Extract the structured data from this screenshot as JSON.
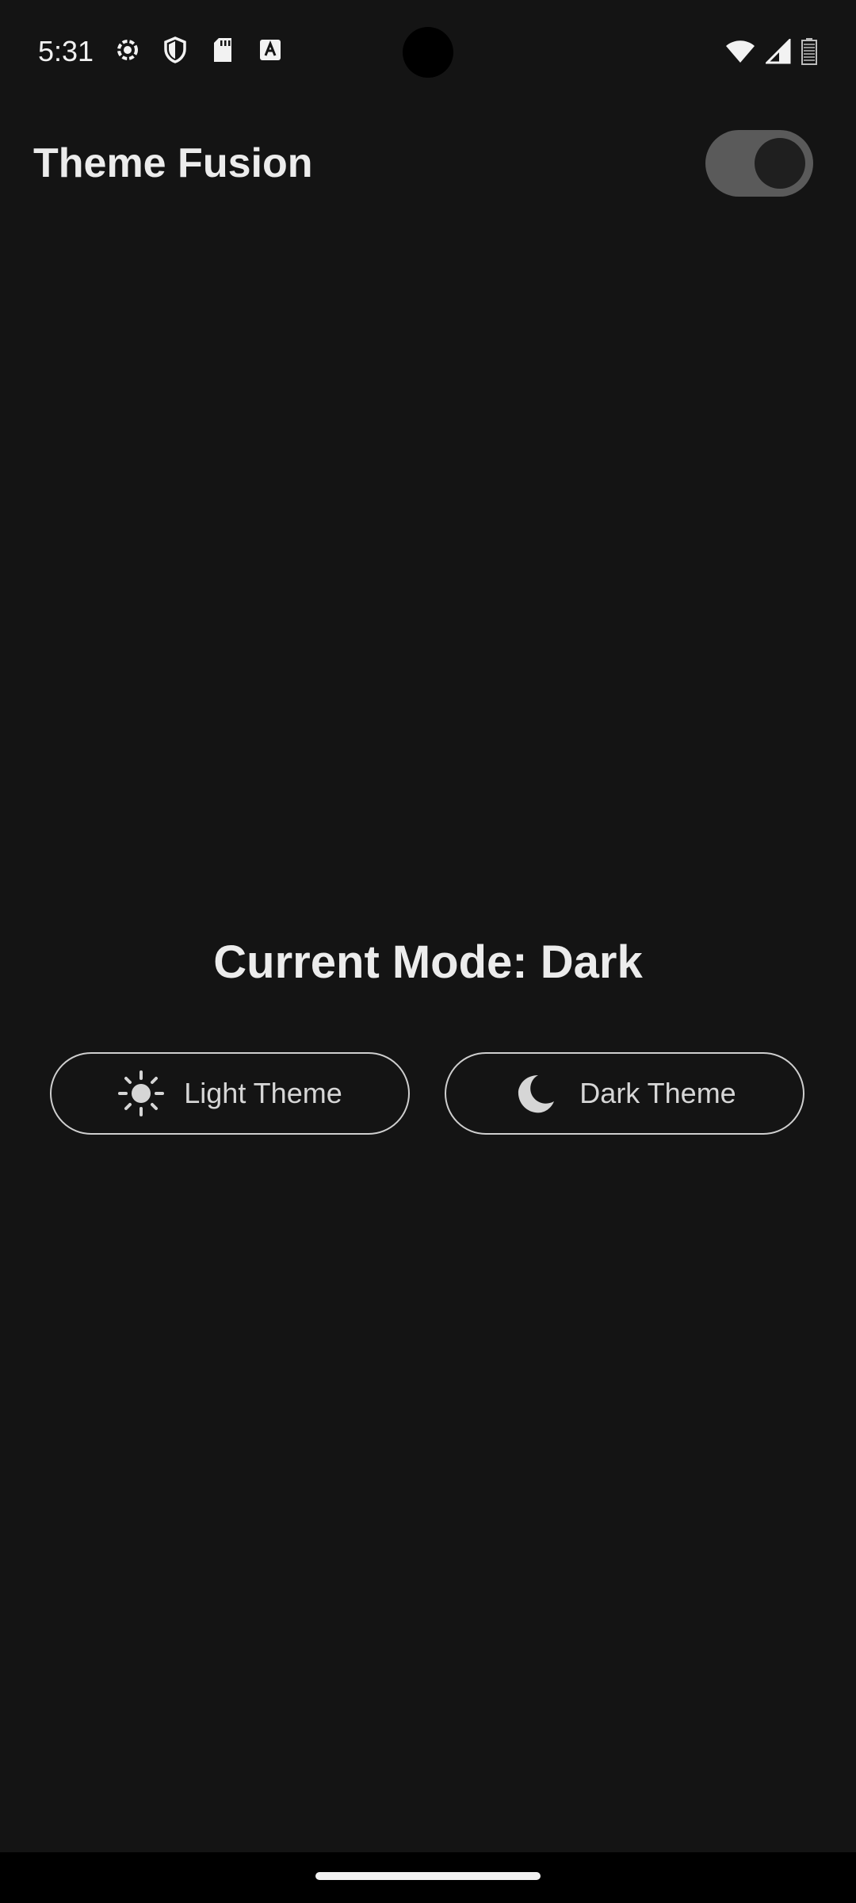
{
  "status_bar": {
    "time": "5:31",
    "icons": [
      "settings-gear-icon",
      "shield-icon",
      "sd-card-icon",
      "font-a-icon",
      "wifi-icon",
      "signal-icon",
      "battery-icon"
    ]
  },
  "app_bar": {
    "title": "Theme Fusion",
    "toggle_state": "on"
  },
  "main": {
    "mode_label": "Current Mode: Dark",
    "buttons": [
      {
        "label": "Light Theme",
        "icon": "sun-icon"
      },
      {
        "label": "Dark Theme",
        "icon": "moon-icon"
      }
    ]
  },
  "colors": {
    "background": "#141414",
    "text": "#ececec",
    "toggle_track": "#5a5a5a",
    "toggle_knob": "#1f1f1f",
    "button_border": "#cfcfcf"
  }
}
